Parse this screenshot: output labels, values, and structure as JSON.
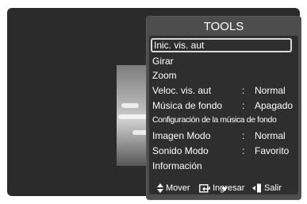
{
  "tools_menu": {
    "title": "TOOLS",
    "items": [
      {
        "label": "Inic. vis. aut",
        "value": "",
        "selected": true
      },
      {
        "label": "Girar",
        "value": ""
      },
      {
        "label": "Zoom",
        "value": ""
      },
      {
        "label": "Veloc. vis. aut",
        "value": "Normal"
      },
      {
        "label": "Música de fondo",
        "value": "Apagado"
      },
      {
        "label": "Configuración de la música de fondo",
        "value": ""
      },
      {
        "label": "Imagen Modo",
        "value": "Normal"
      },
      {
        "label": "Sonido Modo",
        "value": "Favorito"
      },
      {
        "label": "Información",
        "value": ""
      }
    ],
    "separator": ":",
    "scroll_indicator": "more-items-below"
  },
  "footer": {
    "move_label": "Mover",
    "enter_label": "Ingresar",
    "exit_label": "Salir"
  },
  "colors": {
    "screen_bg": "#2b2b2b",
    "panel_bg": "#4d4d4d",
    "menu_bg": "#2e2e2e",
    "text": "#ffffff",
    "selection_border": "#d9d9d9"
  }
}
